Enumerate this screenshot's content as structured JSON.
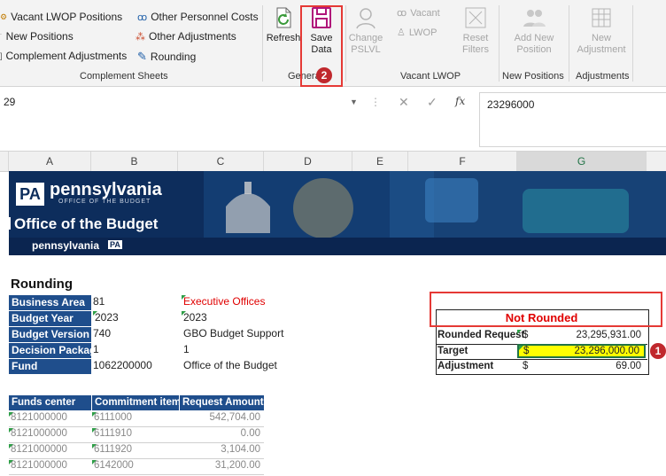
{
  "ribbon": {
    "complement": {
      "items": [
        "Vacant LWOP Positions",
        "New Positions",
        "Complement Adjustments",
        "Other Personnel Costs",
        "Other Adjustments",
        "Rounding"
      ],
      "group_label": "Complement Sheets"
    },
    "general": {
      "refresh_label": "Refresh",
      "save_label_1": "Save",
      "save_label_2": "Data",
      "group_label": "General",
      "badge": "2"
    },
    "vacant_lwop": {
      "change_label_1": "Change",
      "change_label_2": "PSLVL",
      "vacant_label": "Vacant",
      "lwop_label": "LWOP",
      "reset_label_1": "Reset",
      "reset_label_2": "Filters",
      "group_label": "Vacant LWOP"
    },
    "new_positions": {
      "add_label_1": "Add New",
      "add_label_2": "Position",
      "group_label": "New Positions"
    },
    "adjustments": {
      "new_label_1": "New",
      "new_label_2": "Adjustment",
      "group_label": "Adjustments"
    }
  },
  "formula_bar": {
    "name_box": "29",
    "fx": "fx",
    "value": "23296000"
  },
  "columns": [
    "A",
    "B",
    "C",
    "D",
    "E",
    "F",
    "G"
  ],
  "banner": {
    "logo_mark": "PA",
    "logo_word": "pennsylvania",
    "logo_sub": "OFFICE OF THE BUDGET",
    "title": "Office of the Budget",
    "footer_word": "pennsylvania",
    "footer_mark": "PA"
  },
  "sheet": {
    "heading": "Rounding",
    "fields": [
      {
        "label": "Business Area",
        "value": "81",
        "desc": "Executive Offices"
      },
      {
        "label": "Budget Year",
        "value": "2023",
        "desc": "2023"
      },
      {
        "label": "Budget Version",
        "value": "740",
        "desc": "GBO Budget Support"
      },
      {
        "label": "Decision Packag",
        "value": "1",
        "desc": "1"
      },
      {
        "label": "Fund",
        "value": "1062200000",
        "desc": "Office of the Budget"
      }
    ],
    "table_headers": [
      "Funds center",
      "Commitment item",
      "Request Amount"
    ],
    "rows": [
      [
        "8121000000",
        "6111000",
        "542,704.00"
      ],
      [
        "8121000000",
        "6111910",
        "0.00"
      ],
      [
        "8121000000",
        "6111920",
        "3,104.00"
      ],
      [
        "8121000000",
        "6142000",
        "31,200.00"
      ]
    ],
    "summary": {
      "status": "Not Rounded",
      "rows": [
        {
          "label": "Rounded Request",
          "currency": "$",
          "amount": "23,295,931.00"
        },
        {
          "label": "Target",
          "currency": "$",
          "amount": "23,296,000.00"
        },
        {
          "label": "Adjustment",
          "currency": "$",
          "amount": "69.00"
        }
      ],
      "badge": "1"
    }
  },
  "colors": {
    "accent_red": "#e53935",
    "header_blue": "#1f4e8c",
    "highlight_yellow": "#ffff00",
    "status_red": "#e00000"
  }
}
